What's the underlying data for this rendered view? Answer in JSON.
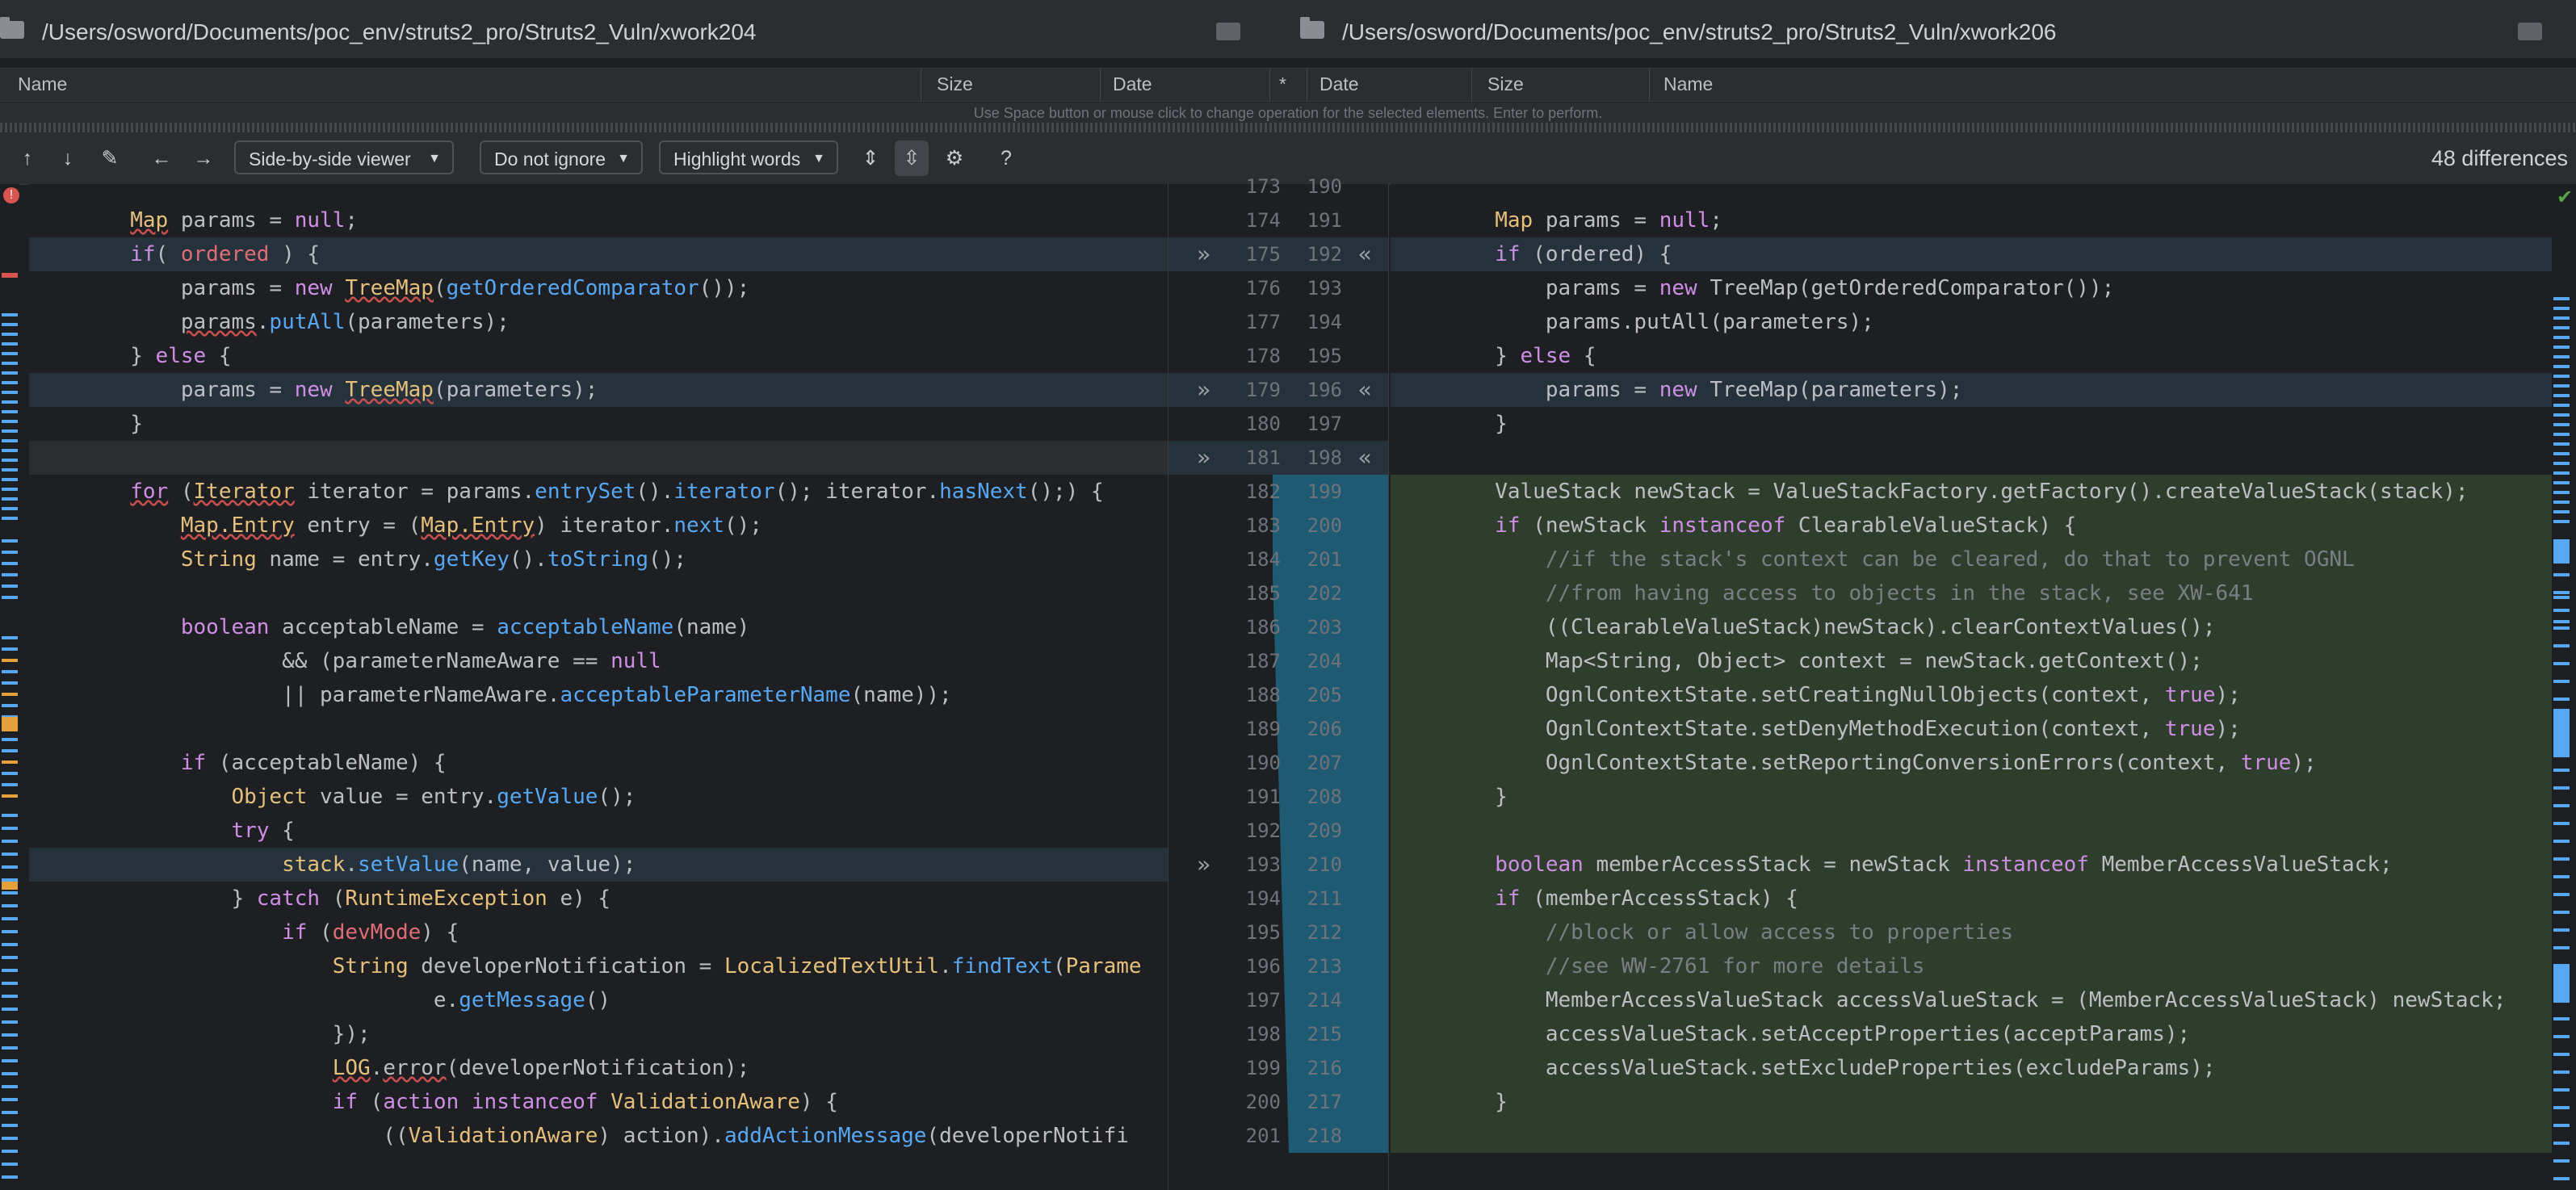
{
  "left_path": "/Users/osword/Documents/poc_env/struts2_pro/Struts2_Vuln/xwork204",
  "right_path": "/Users/osword/Documents/poc_env/struts2_pro/Struts2_Vuln/xwork206",
  "columns_left": [
    "Name",
    "Size",
    "Date",
    "*"
  ],
  "columns_right": [
    "Date",
    "Size",
    "Name"
  ],
  "hint": "Use Space button or mouse click to change operation for the selected elements. Enter to perform.",
  "toolbar": {
    "viewer": "Side-by-side viewer",
    "ignore": "Do not ignore",
    "highlight": "Highlight words",
    "help": "?",
    "differences": "48 differences"
  },
  "colors": {
    "changed_bg": "#25323b",
    "inserted_bg": "#2f3e2c",
    "divider_changed": "#1f5a73",
    "error": "#d9534f",
    "ok": "#57a64a"
  },
  "left_lines": [
    {
      "n": "173",
      "html": ""
    },
    {
      "n": "174",
      "html": "        <span class='cl un'>Map</span> params = <span class='kw'>null</span>;"
    },
    {
      "n": "175",
      "html": "        <span class='kw'>if</span>( <span class='str' style='color:#e06c75'>ordered</span> ) {"
    },
    {
      "n": "176",
      "html": "            params = <span class='kw'>new</span> <span class='cl un'>TreeMap</span>(<span class='fn'>getOrderedComparator</span>());"
    },
    {
      "n": "177",
      "html": "            <span class='un'>params</span>.<span class='fn'>putAll</span>(parameters);"
    },
    {
      "n": "178",
      "html": "        } <span class='kw'>else</span> {"
    },
    {
      "n": "179",
      "html": "            params = <span class='kw'>new</span> <span class='cl un'>TreeMap</span>(parameters);"
    },
    {
      "n": "180",
      "html": "        }"
    },
    {
      "n": "181",
      "html": ""
    },
    {
      "n": "182",
      "html": "        <span class='kw un'>for</span> (<span class='cl un'>Iterator</span> iterator = params.<span class='fn'>entrySet</span>().<span class='fn'>iterator</span>(); iterator.<span class='fn'>hasNext</span>();) {"
    },
    {
      "n": "183",
      "html": "            <span class='cl un'>Map.Entry</span> entry = (<span class='cl un'>Map.Entry</span>) iterator.<span class='fn'>next</span>();"
    },
    {
      "n": "184",
      "html": "            <span class='cl'>String</span> name = entry.<span class='fn'>getKey</span>().<span class='fn'>toString</span>();"
    },
    {
      "n": "185",
      "html": ""
    },
    {
      "n": "186",
      "html": "            <span class='kw'>boolean</span> acceptableName = <span class='fn'>acceptableName</span>(name)"
    },
    {
      "n": "187",
      "html": "                    &amp;&amp; (parameterNameAware == <span class='kw'>null</span>"
    },
    {
      "n": "188",
      "html": "                    || parameterNameAware.<span class='fn'>acceptableParameterName</span>(name));"
    },
    {
      "n": "189",
      "html": ""
    },
    {
      "n": "190",
      "html": "            <span class='kw'>if</span> (acceptableName) {"
    },
    {
      "n": "191",
      "html": "                <span class='cl'>Object</span> value = entry.<span class='fn'>getValue</span>();"
    },
    {
      "n": "192",
      "html": "                <span class='kw'>try</span> {"
    },
    {
      "n": "193",
      "html": "                    <span class='cl'>stack</span>.<span class='fn'>setValue</span>(name, value);"
    },
    {
      "n": "194",
      "html": "                } <span class='kw'>catch</span> (<span class='cl'>RuntimeException</span> e) {"
    },
    {
      "n": "195",
      "html": "                    <span class='kw'>if</span> (<span class='str' style='color:#e06c75'>devMode</span>) {"
    },
    {
      "n": "196",
      "html": "                        <span class='cl'>String</span> developerNotification = <span class='cl'>LocalizedTextUtil</span>.<span class='fn'>findText</span>(<span class='cl'>Parame</span>"
    },
    {
      "n": "197",
      "html": "                                e.<span class='fn'>getMessage</span>()"
    },
    {
      "n": "198",
      "html": "                        });"
    },
    {
      "n": "199",
      "html": "                        <span class='cl un'>LOG</span>.<span class='un'>error</span>(developerNotification);"
    },
    {
      "n": "200",
      "html": "                        <span class='kw'>if</span> (<span class='kw'>action</span> <span class='kw'>instanceof</span> <span class='cl'>ValidationAware</span>) {"
    },
    {
      "n": "201",
      "html": "                            ((<span class='cl'>ValidationAware</span>) action).<span class='fn'>addActionMessage</span>(developerNotifi"
    }
  ],
  "right_lines": [
    {
      "n": "190",
      "html": ""
    },
    {
      "n": "191",
      "html": "        <span class='cl'>Map</span> params = <span class='kw'>null</span>;"
    },
    {
      "n": "192",
      "html": "        <span class='kw'>if</span> (ordered) {"
    },
    {
      "n": "193",
      "html": "            params = <span class='kw'>new</span> TreeMap(getOrderedComparator());"
    },
    {
      "n": "194",
      "html": "            params.putAll(parameters);"
    },
    {
      "n": "195",
      "html": "        } <span class='kw'>else</span> {"
    },
    {
      "n": "196",
      "html": "            params = <span class='kw'>new</span> TreeMap(parameters);"
    },
    {
      "n": "197",
      "html": "        }"
    },
    {
      "n": "198",
      "html": ""
    },
    {
      "n": "199",
      "html": "        ValueStack newStack = ValueStackFactory.getFactory().createValueStack(stack);"
    },
    {
      "n": "200",
      "html": "        <span class='kw'>if</span> (newStack <span class='kw'>instanceof</span> ClearableValueStack) {"
    },
    {
      "n": "201",
      "html": "            <span class='cm'>//if the stack's context can be cleared, do that to prevent OGNL</span>"
    },
    {
      "n": "202",
      "html": "            <span class='cm'>//from having access to objects in the stack, see XW-641</span>"
    },
    {
      "n": "203",
      "html": "            ((ClearableValueStack)newStack).clearContextValues();"
    },
    {
      "n": "204",
      "html": "            Map&lt;String, Object&gt; context = newStack.getContext();"
    },
    {
      "n": "205",
      "html": "            OgnlContextState.setCreatingNullObjects(context, <span class='kw'>true</span>);"
    },
    {
      "n": "206",
      "html": "            OgnlContextState.setDenyMethodExecution(context, <span class='kw'>true</span>);"
    },
    {
      "n": "207",
      "html": "            OgnlContextState.setReportingConversionErrors(context, <span class='kw'>true</span>);"
    },
    {
      "n": "208",
      "html": "        }"
    },
    {
      "n": "209",
      "html": ""
    },
    {
      "n": "210",
      "html": "        <span class='kw'>boolean</span> memberAccessStack = newStack <span class='kw'>instanceof</span> MemberAccessValueStack;"
    },
    {
      "n": "211",
      "html": "        <span class='kw'>if</span> (memberAccessStack) {"
    },
    {
      "n": "212",
      "html": "            <span class='cm'>//block or allow access to properties</span>"
    },
    {
      "n": "213",
      "html": "            <span class='cm'>//see WW-2761 for more details</span>"
    },
    {
      "n": "214",
      "html": "            MemberAccessValueStack accessValueStack = (MemberAccessValueStack) newStack;"
    },
    {
      "n": "215",
      "html": "            accessValueStack.setAcceptProperties(acceptParams);"
    },
    {
      "n": "216",
      "html": "            accessValueStack.setExcludeProperties(excludeParams);"
    },
    {
      "n": "217",
      "html": "        }"
    },
    {
      "n": "218",
      "html": ""
    }
  ]
}
